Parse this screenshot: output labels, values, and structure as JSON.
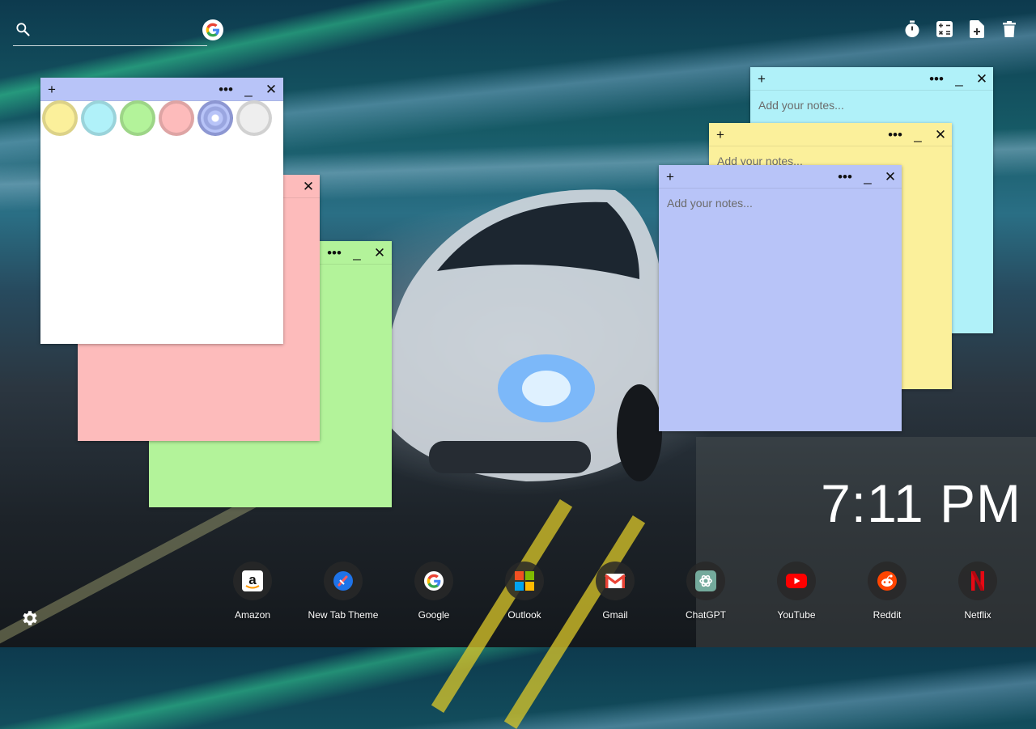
{
  "search": {
    "placeholder": ""
  },
  "tools": [
    {
      "name": "timer-icon"
    },
    {
      "name": "calculator-icon"
    },
    {
      "name": "new-note-icon"
    },
    {
      "name": "trash-icon"
    }
  ],
  "notes": {
    "placeholder": "Add your notes...",
    "controls": {
      "add": "+",
      "menu": "•••",
      "minimize": "_",
      "close": "✕"
    }
  },
  "palette": {
    "colors": [
      "#fbf09b",
      "#b0f1f9",
      "#b3f39a",
      "#fdbbbb",
      "#b8c4f8",
      "#eeeeee"
    ],
    "selected_index": 4
  },
  "clock": {
    "time": "7:11 PM"
  },
  "shortcuts": [
    {
      "label": "Amazon"
    },
    {
      "label": "New Tab Theme"
    },
    {
      "label": "Google"
    },
    {
      "label": "Outlook"
    },
    {
      "label": "Gmail"
    },
    {
      "label": "ChatGPT"
    },
    {
      "label": "YouTube"
    },
    {
      "label": "Reddit"
    },
    {
      "label": "Netflix"
    }
  ]
}
